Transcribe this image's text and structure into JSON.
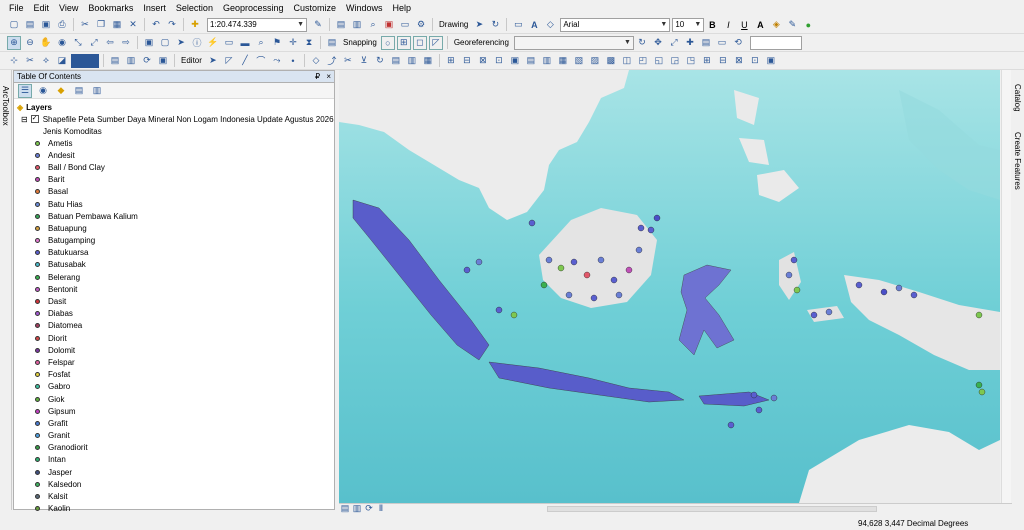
{
  "menu": [
    "File",
    "Edit",
    "View",
    "Bookmarks",
    "Insert",
    "Selection",
    "Geoprocessing",
    "Customize",
    "Windows",
    "Help"
  ],
  "toolbar": {
    "scale": "1:20.474.339",
    "drawing_label": "Drawing",
    "font_name": "Arial",
    "font_size": "10",
    "snapping_label": "Snapping",
    "georeferencing_label": "Georeferencing",
    "editor_label": "Editor"
  },
  "left_dock": {
    "arctoolbox": "ArcToolbox"
  },
  "right_dock": {
    "catalog": "Catalog",
    "create_features": "Create Features"
  },
  "toc": {
    "title": "Table Of Contents",
    "pin": "₽",
    "close": "×",
    "layers_label": "Layers",
    "layer_name": "Shapefile Peta Sumber Daya Mineral Non Logam Indonesia Update Agustus 2026",
    "field_name": "Jenis Komoditas",
    "items": [
      {
        "label": "Ametis",
        "color": "#7ec850"
      },
      {
        "label": "Andesit",
        "color": "#6a7fd6"
      },
      {
        "label": "Ball / Bond Clay",
        "color": "#e2586a"
      },
      {
        "label": "Barit",
        "color": "#c050b8"
      },
      {
        "label": "Basal",
        "color": "#e07a3a"
      },
      {
        "label": "Batu Hias",
        "color": "#6a8bd6"
      },
      {
        "label": "Batuan Pembawa Kalium",
        "color": "#3aa55a"
      },
      {
        "label": "Batuapung",
        "color": "#d4a040"
      },
      {
        "label": "Batugamping",
        "color": "#e07ad0"
      },
      {
        "label": "Batukuarsa",
        "color": "#5a5fd0"
      },
      {
        "label": "Batusabak",
        "color": "#4ab8c8"
      },
      {
        "label": "Belerang",
        "color": "#3ab050"
      },
      {
        "label": "Bentonit",
        "color": "#c060c8"
      },
      {
        "label": "Dasit",
        "color": "#d0343a"
      },
      {
        "label": "Diabas",
        "color": "#a05ad0"
      },
      {
        "label": "Diatomea",
        "color": "#a04060"
      },
      {
        "label": "Diorit",
        "color": "#d04848"
      },
      {
        "label": "Dolomit",
        "color": "#7a3aa0"
      },
      {
        "label": "Felspar",
        "color": "#e060a0"
      },
      {
        "label": "Fosfat",
        "color": "#e0d040"
      },
      {
        "label": "Gabro",
        "color": "#40c0a0"
      },
      {
        "label": "Giok",
        "color": "#60b040"
      },
      {
        "label": "Gipsum",
        "color": "#c040c0"
      },
      {
        "label": "Grafit",
        "color": "#4a7ad0"
      },
      {
        "label": "Granit",
        "color": "#50a0e0"
      },
      {
        "label": "Granodiorit",
        "color": "#3a9a48"
      },
      {
        "label": "Intan",
        "color": "#30b070"
      },
      {
        "label": "Jasper",
        "color": "#405080"
      },
      {
        "label": "Kalsedon",
        "color": "#40b060"
      },
      {
        "label": "Kalsit",
        "color": "#5a6a78"
      },
      {
        "label": "Kaolin",
        "color": "#6aa040"
      }
    ]
  },
  "status": {
    "coords": "94,628  3,447 Decimal Degrees"
  }
}
